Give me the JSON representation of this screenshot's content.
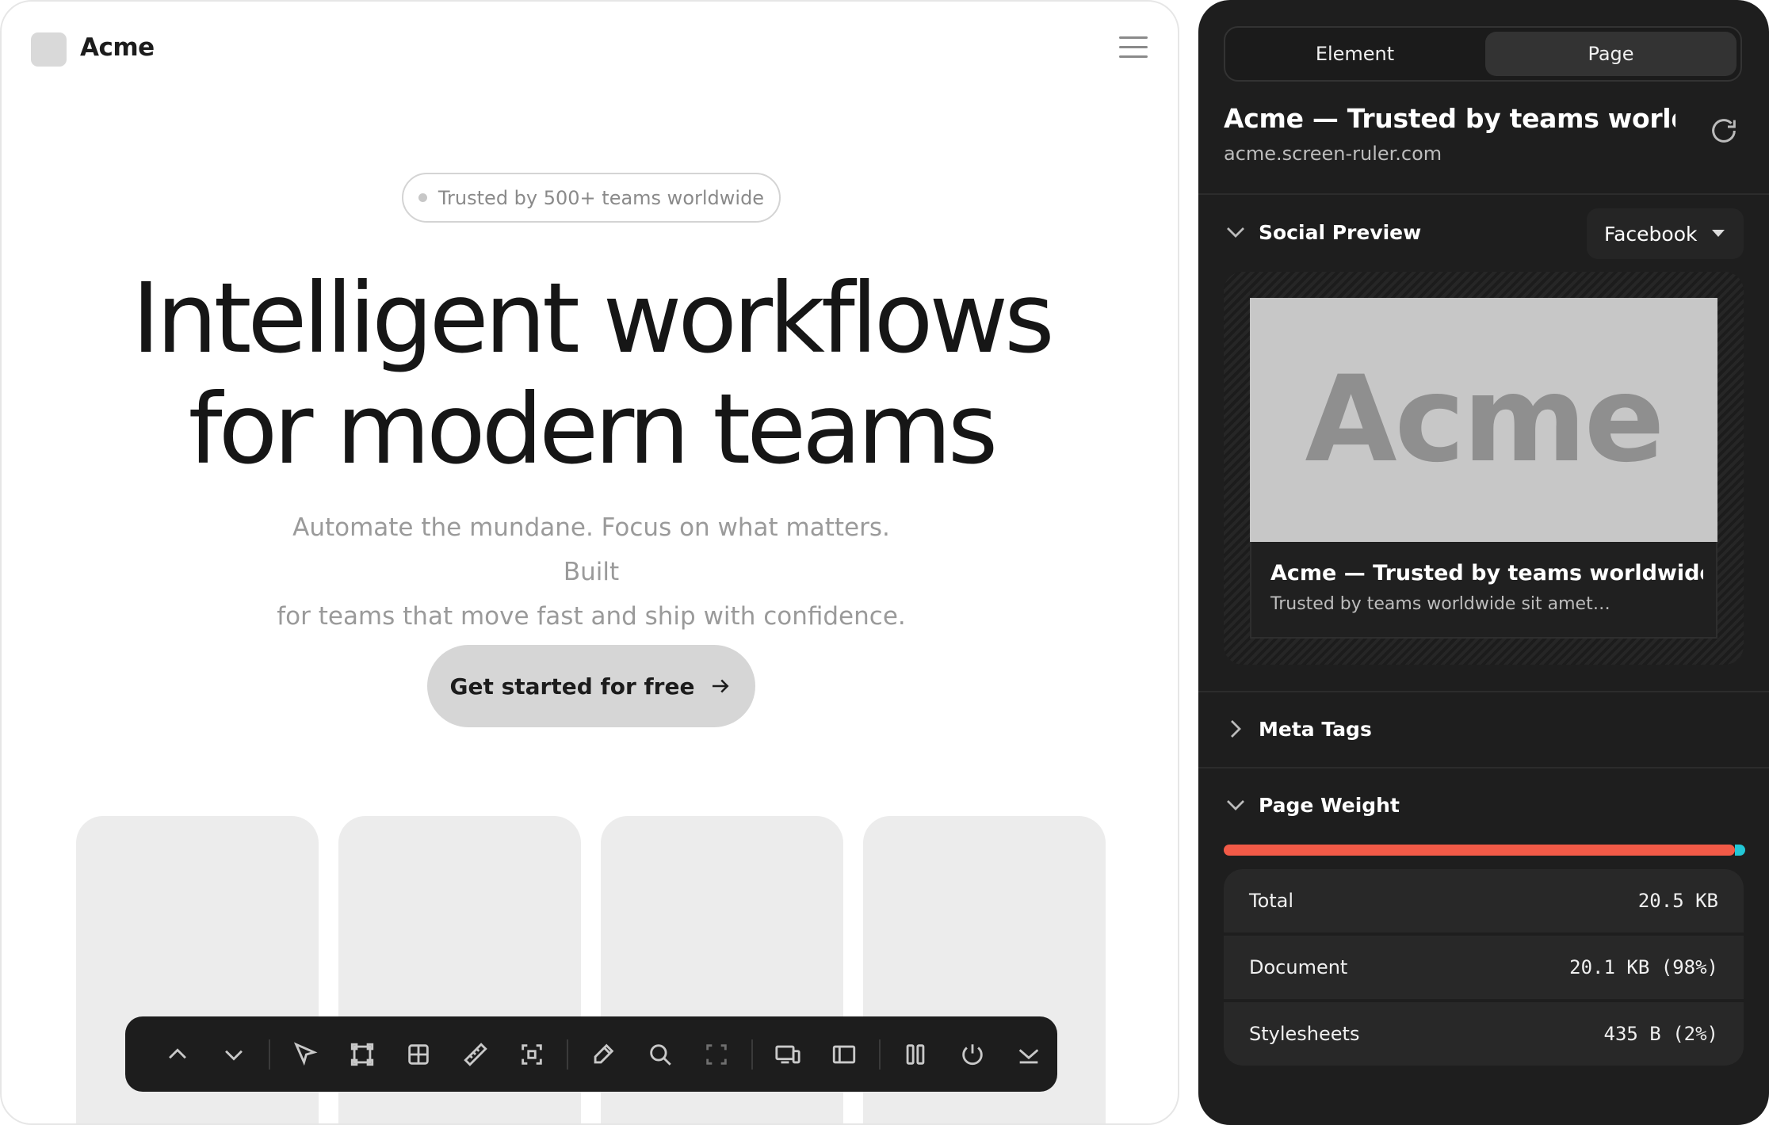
{
  "site": {
    "logo_text": "Acme",
    "badge": "Trusted by 500+ teams worldwide",
    "hero_line1": "Intelligent workflows",
    "hero_line2": "for modern teams",
    "subtitle_line1": "Automate the mundane. Focus on what matters. Built",
    "subtitle_line2": "for teams that move fast and ship with confidence.",
    "cta_label": "Get started for free"
  },
  "toolbar": {
    "icons": [
      "chevron-up-icon",
      "chevron-down-icon",
      "cursor-icon",
      "frame-icon",
      "grid-icon",
      "ruler-icon",
      "crop-icon",
      "eyedropper-icon",
      "search-icon",
      "fullscreen-icon",
      "devices-icon",
      "sidebar-icon",
      "columns-icon",
      "power-icon",
      "collapse-icon"
    ]
  },
  "panel": {
    "tabs": [
      {
        "label": "Element",
        "active": false
      },
      {
        "label": "Page",
        "active": true
      }
    ],
    "page_title": "Acme — Trusted by teams worldwi…",
    "page_url": "acme.screen-ruler.com",
    "social_preview": {
      "heading": "Social Preview",
      "platform": "Facebook",
      "image_text": "Acme",
      "card_title": "Acme — Trusted by teams worldwide s…",
      "card_desc": "Trusted by teams worldwide sit amet…"
    },
    "meta_tags": {
      "heading": "Meta Tags"
    },
    "page_weight": {
      "heading": "Page Weight",
      "document_share": 0.98,
      "rows": [
        {
          "label": "Total",
          "value": "20.5 KB"
        },
        {
          "label": "Document",
          "value": "20.1 KB (98%)"
        },
        {
          "label": "Stylesheets",
          "value": "435 B (2%)"
        }
      ]
    }
  },
  "colors": {
    "bar_document": "#f25a47",
    "bar_stylesheets": "#22c7d6",
    "panel_bg": "#1e1e1e"
  }
}
